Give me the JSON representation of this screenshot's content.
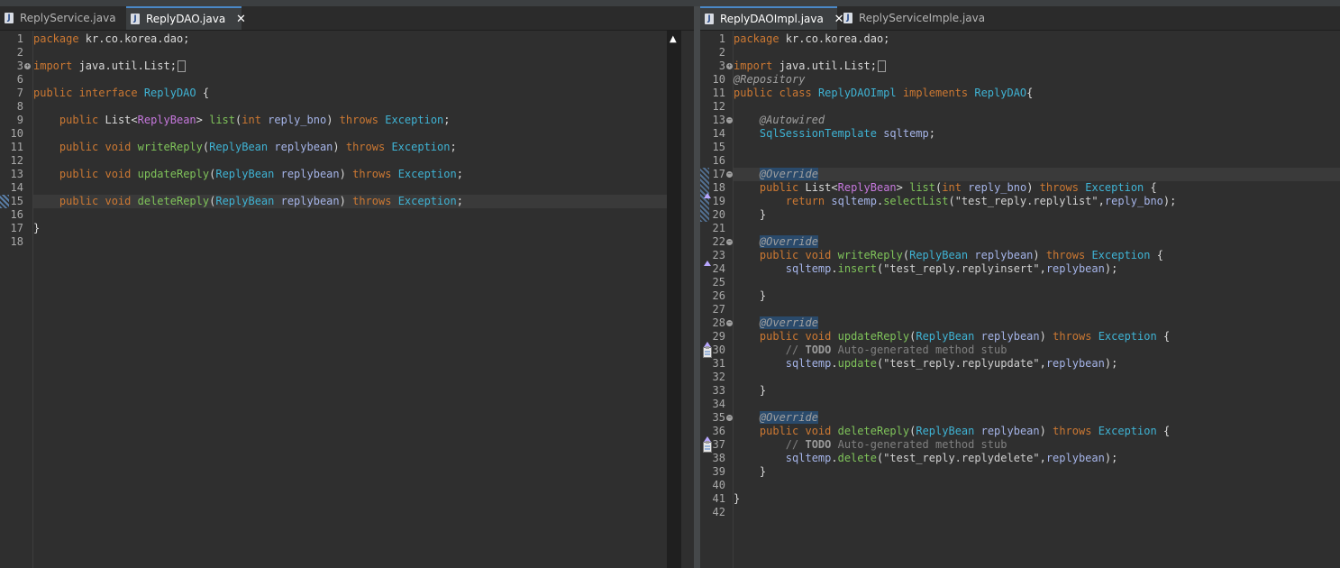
{
  "left": {
    "tabs": [
      {
        "label": "ReplyService.java",
        "active": false
      },
      {
        "label": "ReplyDAO.java",
        "active": true
      }
    ],
    "lines": [
      {
        "n": "1",
        "tokens": [
          [
            "k",
            "package"
          ],
          [
            "p",
            " kr.co.korea.dao;"
          ]
        ]
      },
      {
        "n": "2",
        "tokens": []
      },
      {
        "n": "3",
        "fold": "plus",
        "tokens": [
          [
            "k",
            "import"
          ],
          [
            "p",
            " java.util.List;"
          ]
        ],
        "box": true
      },
      {
        "n": "6",
        "tokens": []
      },
      {
        "n": "7",
        "tokens": [
          [
            "k",
            "public interface"
          ],
          [
            "p",
            " "
          ],
          [
            "t",
            "ReplyDAO"
          ],
          [
            "p",
            " {"
          ]
        ]
      },
      {
        "n": "8",
        "tokens": []
      },
      {
        "n": "9",
        "tokens": [
          [
            "p",
            "    "
          ],
          [
            "k",
            "public"
          ],
          [
            "p",
            " List<"
          ],
          [
            "g",
            "ReplyBean"
          ],
          [
            "p",
            "> "
          ],
          [
            "m",
            "list"
          ],
          [
            "p",
            "("
          ],
          [
            "k",
            "int"
          ],
          [
            "p",
            " "
          ],
          [
            "v",
            "reply_bno"
          ],
          [
            "p",
            ") "
          ],
          [
            "k",
            "throws"
          ],
          [
            "p",
            " "
          ],
          [
            "t",
            "Exception"
          ],
          [
            "p",
            ";"
          ]
        ]
      },
      {
        "n": "10",
        "tokens": []
      },
      {
        "n": "11",
        "tokens": [
          [
            "p",
            "    "
          ],
          [
            "k",
            "public void"
          ],
          [
            "p",
            " "
          ],
          [
            "m",
            "writeReply"
          ],
          [
            "p",
            "("
          ],
          [
            "t",
            "ReplyBean"
          ],
          [
            "p",
            " "
          ],
          [
            "v",
            "replybean"
          ],
          [
            "p",
            ") "
          ],
          [
            "k",
            "throws"
          ],
          [
            "p",
            " "
          ],
          [
            "t",
            "Exception"
          ],
          [
            "p",
            ";"
          ]
        ]
      },
      {
        "n": "12",
        "tokens": []
      },
      {
        "n": "13",
        "tokens": [
          [
            "p",
            "    "
          ],
          [
            "k",
            "public void"
          ],
          [
            "p",
            " "
          ],
          [
            "m",
            "updateReply"
          ],
          [
            "p",
            "("
          ],
          [
            "t",
            "ReplyBean"
          ],
          [
            "p",
            " "
          ],
          [
            "v",
            "replybean"
          ],
          [
            "p",
            ") "
          ],
          [
            "k",
            "throws"
          ],
          [
            "p",
            " "
          ],
          [
            "t",
            "Exception"
          ],
          [
            "p",
            ";"
          ]
        ]
      },
      {
        "n": "14",
        "tokens": []
      },
      {
        "n": "15",
        "current": true,
        "tokens": [
          [
            "p",
            "    "
          ],
          [
            "k",
            "public void"
          ],
          [
            "p",
            " "
          ],
          [
            "m",
            "deleteReply"
          ],
          [
            "p",
            "("
          ],
          [
            "t",
            "ReplyBean"
          ],
          [
            "p",
            " "
          ],
          [
            "v",
            "replybean"
          ],
          [
            "p",
            ") "
          ],
          [
            "k",
            "throws"
          ],
          [
            "p",
            " "
          ],
          [
            "t",
            "Exception"
          ],
          [
            "p",
            ";"
          ]
        ]
      },
      {
        "n": "16",
        "tokens": []
      },
      {
        "n": "17",
        "tokens": [
          [
            "p",
            "}"
          ]
        ]
      },
      {
        "n": "18",
        "tokens": []
      }
    ]
  },
  "right": {
    "tabs": [
      {
        "label": "ReplyDAOImpl.java",
        "active": true
      },
      {
        "label": "ReplyServiceImple.java",
        "active": false
      }
    ],
    "lines": [
      {
        "n": "1",
        "tokens": [
          [
            "k",
            "package"
          ],
          [
            "p",
            " kr.co.korea.dao;"
          ]
        ]
      },
      {
        "n": "2",
        "tokens": []
      },
      {
        "n": "3",
        "fold": "plus",
        "tokens": [
          [
            "k",
            "import"
          ],
          [
            "p",
            " java.util.List;"
          ]
        ],
        "box": true
      },
      {
        "n": "10",
        "tokens": [
          [
            "a",
            "@Repository"
          ]
        ]
      },
      {
        "n": "11",
        "tokens": [
          [
            "k",
            "public class"
          ],
          [
            "p",
            " "
          ],
          [
            "t",
            "ReplyDAOImpl"
          ],
          [
            "p",
            " "
          ],
          [
            "k",
            "implements"
          ],
          [
            "p",
            " "
          ],
          [
            "t",
            "ReplyDAO"
          ],
          [
            "p",
            "{"
          ]
        ]
      },
      {
        "n": "12",
        "tokens": []
      },
      {
        "n": "13",
        "fold": "minus",
        "tokens": [
          [
            "p",
            "    "
          ],
          [
            "a",
            "@Autowired"
          ]
        ]
      },
      {
        "n": "14",
        "tokens": [
          [
            "p",
            "    "
          ],
          [
            "t",
            "SqlSessionTemplate"
          ],
          [
            "p",
            " "
          ],
          [
            "v",
            "sqltemp"
          ],
          [
            "p",
            ";"
          ]
        ]
      },
      {
        "n": "15",
        "tokens": []
      },
      {
        "n": "16",
        "tokens": []
      },
      {
        "n": "17",
        "fold": "minus",
        "current": true,
        "tokens": [
          [
            "p",
            "    "
          ],
          [
            "ann",
            "@Override"
          ]
        ]
      },
      {
        "n": "18",
        "ovr": true,
        "tokens": [
          [
            "p",
            "    "
          ],
          [
            "k",
            "public"
          ],
          [
            "p",
            " List<"
          ],
          [
            "g",
            "ReplyBean"
          ],
          [
            "p",
            "> "
          ],
          [
            "m",
            "list"
          ],
          [
            "p",
            "("
          ],
          [
            "k",
            "int"
          ],
          [
            "p",
            " "
          ],
          [
            "v",
            "reply_bno"
          ],
          [
            "p",
            ") "
          ],
          [
            "k",
            "throws"
          ],
          [
            "p",
            " "
          ],
          [
            "t",
            "Exception"
          ],
          [
            "p",
            " {"
          ]
        ]
      },
      {
        "n": "19",
        "tokens": [
          [
            "p",
            "        "
          ],
          [
            "k",
            "return"
          ],
          [
            "p",
            " "
          ],
          [
            "v",
            "sqltemp"
          ],
          [
            "p",
            "."
          ],
          [
            "m",
            "selectList"
          ],
          [
            "p",
            "("
          ],
          [
            "s",
            "\"test_reply.replylist\""
          ],
          [
            "p",
            ","
          ],
          [
            "v",
            "reply_bno"
          ],
          [
            "p",
            ");"
          ]
        ]
      },
      {
        "n": "20",
        "tokens": [
          [
            "p",
            "    }"
          ]
        ]
      },
      {
        "n": "21",
        "tokens": []
      },
      {
        "n": "22",
        "fold": "minus",
        "tokens": [
          [
            "p",
            "    "
          ],
          [
            "ann",
            "@Override"
          ]
        ]
      },
      {
        "n": "23",
        "ovr": true,
        "tokens": [
          [
            "p",
            "    "
          ],
          [
            "k",
            "public void"
          ],
          [
            "p",
            " "
          ],
          [
            "m",
            "writeReply"
          ],
          [
            "p",
            "("
          ],
          [
            "t",
            "ReplyBean"
          ],
          [
            "p",
            " "
          ],
          [
            "v",
            "replybean"
          ],
          [
            "p",
            ") "
          ],
          [
            "k",
            "throws"
          ],
          [
            "p",
            " "
          ],
          [
            "t",
            "Exception"
          ],
          [
            "p",
            " {"
          ]
        ]
      },
      {
        "n": "24",
        "tokens": [
          [
            "p",
            "        "
          ],
          [
            "v",
            "sqltemp"
          ],
          [
            "p",
            "."
          ],
          [
            "m",
            "insert"
          ],
          [
            "p",
            "("
          ],
          [
            "s",
            "\"test_reply.replyinsert\""
          ],
          [
            "p",
            ","
          ],
          [
            "v",
            "replybean"
          ],
          [
            "p",
            ");"
          ]
        ]
      },
      {
        "n": "25",
        "tokens": []
      },
      {
        "n": "26",
        "tokens": [
          [
            "p",
            "    }"
          ]
        ]
      },
      {
        "n": "27",
        "tokens": []
      },
      {
        "n": "28",
        "fold": "minus",
        "tokens": [
          [
            "p",
            "    "
          ],
          [
            "ann",
            "@Override"
          ]
        ]
      },
      {
        "n": "29",
        "ovr": true,
        "tokens": [
          [
            "p",
            "    "
          ],
          [
            "k",
            "public void"
          ],
          [
            "p",
            " "
          ],
          [
            "m",
            "updateReply"
          ],
          [
            "p",
            "("
          ],
          [
            "t",
            "ReplyBean"
          ],
          [
            "p",
            " "
          ],
          [
            "v",
            "replybean"
          ],
          [
            "p",
            ") "
          ],
          [
            "k",
            "throws"
          ],
          [
            "p",
            " "
          ],
          [
            "t",
            "Exception"
          ],
          [
            "p",
            " {"
          ]
        ]
      },
      {
        "n": "30",
        "task": true,
        "tokens": [
          [
            "p",
            "        "
          ],
          [
            "c",
            "// "
          ],
          [
            "todo",
            "TODO"
          ],
          [
            "c",
            " Auto-generated method stub"
          ]
        ]
      },
      {
        "n": "31",
        "tokens": [
          [
            "p",
            "        "
          ],
          [
            "v",
            "sqltemp"
          ],
          [
            "p",
            "."
          ],
          [
            "m",
            "update"
          ],
          [
            "p",
            "("
          ],
          [
            "s",
            "\"test_reply.replyupdate\""
          ],
          [
            "p",
            ","
          ],
          [
            "v",
            "replybean"
          ],
          [
            "p",
            ");"
          ]
        ]
      },
      {
        "n": "32",
        "tokens": []
      },
      {
        "n": "33",
        "tokens": [
          [
            "p",
            "    }"
          ]
        ]
      },
      {
        "n": "34",
        "tokens": []
      },
      {
        "n": "35",
        "fold": "minus",
        "tokens": [
          [
            "p",
            "    "
          ],
          [
            "ann",
            "@Override"
          ]
        ]
      },
      {
        "n": "36",
        "ovr": true,
        "tokens": [
          [
            "p",
            "    "
          ],
          [
            "k",
            "public void"
          ],
          [
            "p",
            " "
          ],
          [
            "m",
            "deleteReply"
          ],
          [
            "p",
            "("
          ],
          [
            "t",
            "ReplyBean"
          ],
          [
            "p",
            " "
          ],
          [
            "v",
            "replybean"
          ],
          [
            "p",
            ") "
          ],
          [
            "k",
            "throws"
          ],
          [
            "p",
            " "
          ],
          [
            "t",
            "Exception"
          ],
          [
            "p",
            " {"
          ]
        ]
      },
      {
        "n": "37",
        "task": true,
        "tokens": [
          [
            "p",
            "        "
          ],
          [
            "c",
            "// "
          ],
          [
            "todo",
            "TODO"
          ],
          [
            "c",
            " Auto-generated method stub"
          ]
        ]
      },
      {
        "n": "38",
        "tokens": [
          [
            "p",
            "        "
          ],
          [
            "v",
            "sqltemp"
          ],
          [
            "p",
            "."
          ],
          [
            "m",
            "delete"
          ],
          [
            "p",
            "("
          ],
          [
            "s",
            "\"test_reply.replydelete\""
          ],
          [
            "p",
            ","
          ],
          [
            "v",
            "replybean"
          ],
          [
            "p",
            ");"
          ]
        ]
      },
      {
        "n": "39",
        "tokens": [
          [
            "p",
            "    }"
          ]
        ]
      },
      {
        "n": "40",
        "tokens": []
      },
      {
        "n": "41",
        "tokens": [
          [
            "p",
            "}"
          ]
        ]
      },
      {
        "n": "42",
        "tokens": []
      }
    ]
  },
  "colors": {
    "background": "#2f2f2f",
    "keyword": "#cc7832",
    "type": "#3fb3d4",
    "method": "#7fc35a",
    "variable": "#a5b4e8",
    "generic": "#c678dd",
    "annotation_highlight": "#2a4a6b",
    "active_tab_accent": "#4a88c7"
  },
  "icons": {
    "tab_file": "java-file-icon",
    "tab_close": "close-icon",
    "fold_plus": "fold-expand-icon",
    "fold_minus": "fold-collapse-icon",
    "override_marker": "override-triangle-icon",
    "task_marker": "task-clipboard-icon",
    "scroll_up": "scroll-up-arrow-icon"
  }
}
